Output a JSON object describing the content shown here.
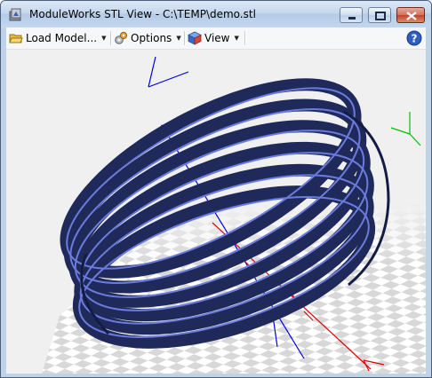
{
  "window": {
    "title": "ModuleWorks STL View - C:\\TEMP\\demo.stl",
    "controls": [
      "minimize",
      "maximize",
      "close"
    ]
  },
  "toolbar": {
    "load_label": "Load Model...",
    "options_label": "Options",
    "view_label": "View",
    "icons": [
      "folder-open-icon",
      "gear-icon",
      "cube-icon",
      "help-icon"
    ]
  },
  "viewport": {
    "model": "helical ring",
    "colors": {
      "model": "#202a5a",
      "model_edge": "#6a7bdc",
      "axis_x": "#e00000",
      "axis_y": "#00c000",
      "axis_z": "#0000e0",
      "background": "#f0f0f0",
      "floor_light": "#ffffff",
      "floor_dark": "#d8d8d8"
    }
  }
}
